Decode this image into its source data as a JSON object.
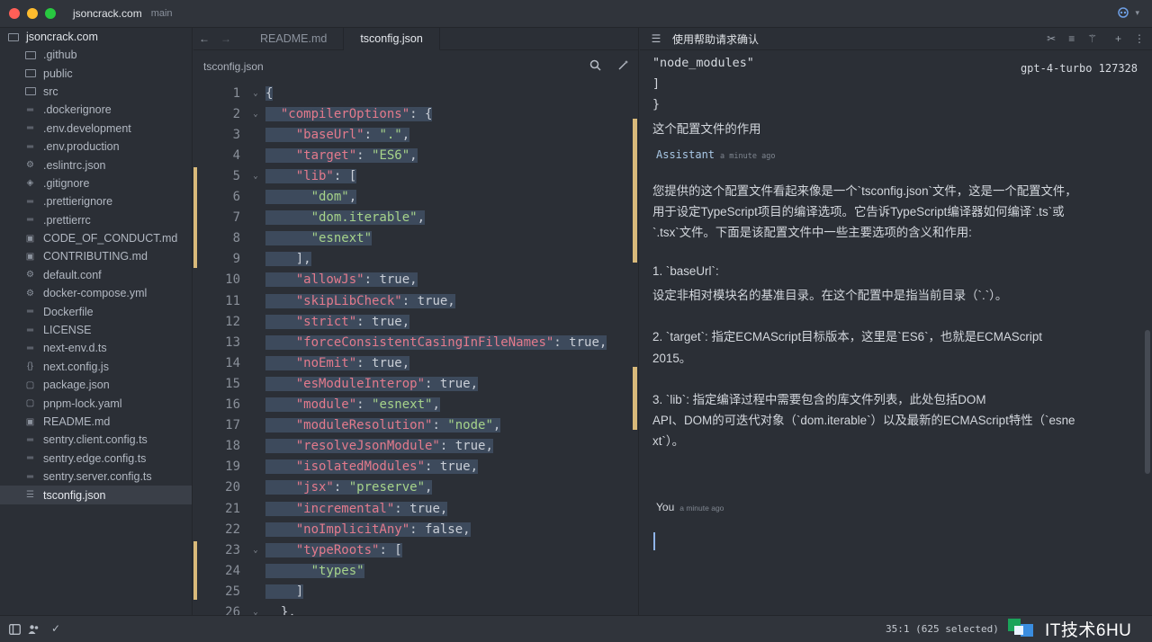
{
  "window": {
    "project": "jsoncrack.com",
    "branch": "main",
    "traffic_lights": [
      "#ff5f57",
      "#febc2e",
      "#28c840"
    ]
  },
  "sidebar": {
    "root": "jsoncrack.com",
    "items": [
      {
        "label": ".github",
        "icon": "folder-icon"
      },
      {
        "label": "public",
        "icon": "folder-icon"
      },
      {
        "label": "src",
        "icon": "folder-icon"
      },
      {
        "label": ".dockerignore",
        "icon": "file-lines-icon"
      },
      {
        "label": ".env.development",
        "icon": "file-lines-icon"
      },
      {
        "label": ".env.production",
        "icon": "file-lines-icon"
      },
      {
        "label": ".eslintrc.json",
        "icon": "gear-icon"
      },
      {
        "label": ".gitignore",
        "icon": "git-icon"
      },
      {
        "label": ".prettierignore",
        "icon": "file-lines-icon"
      },
      {
        "label": ".prettierrc",
        "icon": "file-lines-icon"
      },
      {
        "label": "CODE_OF_CONDUCT.md",
        "icon": "book-icon"
      },
      {
        "label": "CONTRIBUTING.md",
        "icon": "book-icon"
      },
      {
        "label": "default.conf",
        "icon": "gear-icon"
      },
      {
        "label": "docker-compose.yml",
        "icon": "gear-icon"
      },
      {
        "label": "Dockerfile",
        "icon": "file-lines-icon"
      },
      {
        "label": "LICENSE",
        "icon": "file-lines-icon"
      },
      {
        "label": "next-env.d.ts",
        "icon": "file-lines-icon"
      },
      {
        "label": "next.config.js",
        "icon": "braces-icon"
      },
      {
        "label": "package.json",
        "icon": "box-icon"
      },
      {
        "label": "pnpm-lock.yaml",
        "icon": "box-icon"
      },
      {
        "label": "README.md",
        "icon": "book-icon"
      },
      {
        "label": "sentry.client.config.ts",
        "icon": "file-lines-icon"
      },
      {
        "label": "sentry.edge.config.ts",
        "icon": "file-lines-icon"
      },
      {
        "label": "sentry.server.config.ts",
        "icon": "file-lines-icon"
      },
      {
        "label": "tsconfig.json",
        "icon": "database-icon",
        "selected": true
      }
    ]
  },
  "editor": {
    "tabs": [
      {
        "label": "README.md",
        "active": false
      },
      {
        "label": "tsconfig.json",
        "active": true
      }
    ],
    "breadcrumb": "tsconfig.json",
    "lines": [
      {
        "n": "1",
        "fold": true,
        "text": "{"
      },
      {
        "n": "2",
        "fold": true,
        "text": "  \"compilerOptions\": {"
      },
      {
        "n": "3",
        "fold": false,
        "text": "    \"baseUrl\": \".\","
      },
      {
        "n": "4",
        "fold": false,
        "text": "    \"target\": \"ES6\","
      },
      {
        "n": "5",
        "fold": true,
        "text": "    \"lib\": ["
      },
      {
        "n": "6",
        "fold": false,
        "text": "      \"dom\","
      },
      {
        "n": "7",
        "fold": false,
        "text": "      \"dom.iterable\","
      },
      {
        "n": "8",
        "fold": false,
        "text": "      \"esnext\""
      },
      {
        "n": "9",
        "fold": false,
        "text": "    ],"
      },
      {
        "n": "10",
        "fold": false,
        "text": "    \"allowJs\": true,"
      },
      {
        "n": "11",
        "fold": false,
        "text": "    \"skipLibCheck\": true,"
      },
      {
        "n": "12",
        "fold": false,
        "text": "    \"strict\": true,"
      },
      {
        "n": "13",
        "fold": false,
        "text": "    \"forceConsistentCasingInFileNames\": true,"
      },
      {
        "n": "14",
        "fold": false,
        "text": "    \"noEmit\": true,"
      },
      {
        "n": "15",
        "fold": false,
        "text": "    \"esModuleInterop\": true,"
      },
      {
        "n": "16",
        "fold": false,
        "text": "    \"module\": \"esnext\","
      },
      {
        "n": "17",
        "fold": false,
        "text": "    \"moduleResolution\": \"node\","
      },
      {
        "n": "18",
        "fold": false,
        "text": "    \"resolveJsonModule\": true,"
      },
      {
        "n": "19",
        "fold": false,
        "text": "    \"isolatedModules\": true,"
      },
      {
        "n": "20",
        "fold": false,
        "text": "    \"jsx\": \"preserve\","
      },
      {
        "n": "21",
        "fold": false,
        "text": "    \"incremental\": true,"
      },
      {
        "n": "22",
        "fold": false,
        "text": "    \"noImplicitAny\": false,"
      },
      {
        "n": "23",
        "fold": true,
        "text": "    \"typeRoots\": ["
      },
      {
        "n": "24",
        "fold": false,
        "text": "      \"types\""
      },
      {
        "n": "25",
        "fold": false,
        "text": "    ]"
      },
      {
        "n": "26",
        "fold": true,
        "text": "  },"
      }
    ]
  },
  "chat": {
    "title": "使用帮助请求确认",
    "model": "gpt-4-turbo 127328",
    "prev_code": [
      "    \"node_modules\"",
      "  ]",
      "}"
    ],
    "user_prev": "这个配置文件的作用",
    "assistant_label": "Assistant",
    "assistant_time": "a minute ago",
    "answer": [
      "您提供的这个配置文件看起来像是一个`tsconfig.json`文件，这是一个配置文件，",
      "用于设定TypeScript项目的编译选项。它告诉TypeScript编译器如何编译`.ts`或",
      "`.tsx`文件。下面是该配置文件中一些主要选项的含义和作用:",
      "",
      "1. `baseUrl`:",
      "设定非相对模块名的基准目录。在这个配置中是指当前目录（`.`）。",
      "",
      "2. `target`: 指定ECMAScript目标版本，这里是`ES6`，也就是ECMAScript",
      "2015。",
      "",
      "3. `lib`: 指定编译过程中需要包含的库文件列表，此处包括DOM",
      "API、DOM的可迭代对象（`dom.iterable`）以及最新的ECMAScript特性（`esne",
      "xt`）。"
    ],
    "you_label": "You",
    "you_time": "a minute ago"
  },
  "status": {
    "position": "35:1 (625 selected)"
  },
  "watermark": "IT技术6HU"
}
